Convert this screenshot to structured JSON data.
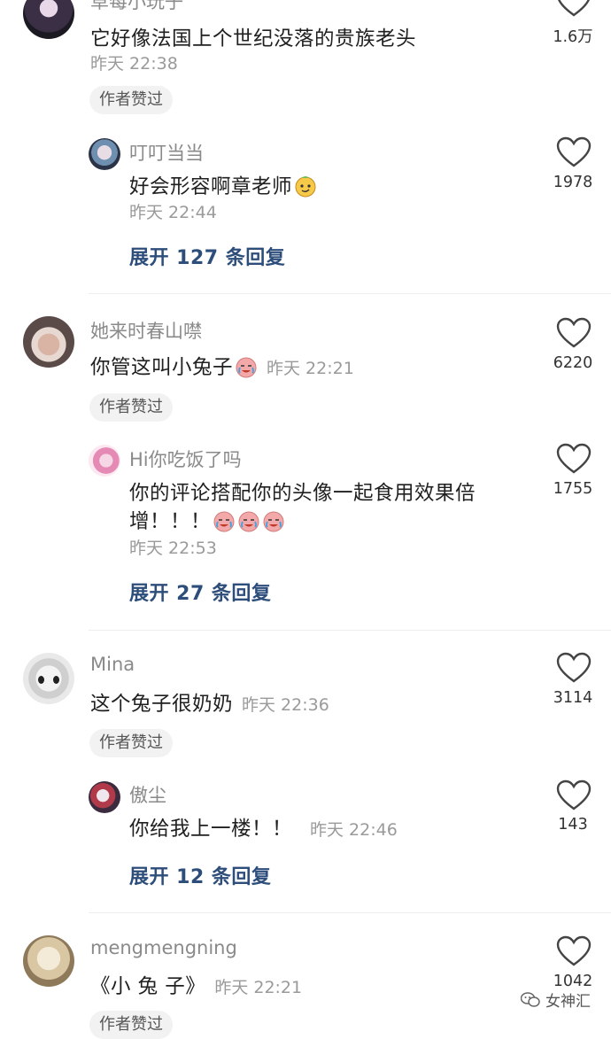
{
  "comments": [
    {
      "name": "草莓小玩子",
      "text": "它好像法国上个世纪没落的贵族老头",
      "time": "昨天 22:38",
      "likes": "1.6万",
      "author_liked": "作者赞过",
      "reply": {
        "name": "叮叮当当",
        "text": "好会形容啊章老师",
        "time": "昨天 22:44",
        "likes": "1978"
      },
      "expand": "展开 127 条回复"
    },
    {
      "name": "她来时春山噤",
      "text": "你管这叫小兔子",
      "time": "昨天 22:21",
      "likes": "6220",
      "author_liked": "作者赞过",
      "reply": {
        "name": "Hi你吃饭了吗",
        "text_line1": "你的评论搭配你的头像一起食用效果倍",
        "text_line2": "增！！！",
        "time": "昨天 22:53",
        "likes": "1755"
      },
      "expand": "展开 27 条回复"
    },
    {
      "name": "Mina",
      "text": "这个兔子很奶奶",
      "time": "昨天 22:36",
      "likes": "3114",
      "author_liked": "作者赞过",
      "reply": {
        "name": "傲尘",
        "text": "你给我上一楼！！",
        "time": "昨天 22:46",
        "likes": "143"
      },
      "expand": "展开 12 条回复"
    },
    {
      "name": "mengmengning",
      "text": "《小 兔 子》",
      "time": "昨天 22:21",
      "likes": "1042",
      "author_liked": "作者赞过"
    }
  ],
  "watermark": "女神汇",
  "icons": {
    "like": "heart-outline-icon",
    "watermark": "wechat-logo-icon"
  }
}
